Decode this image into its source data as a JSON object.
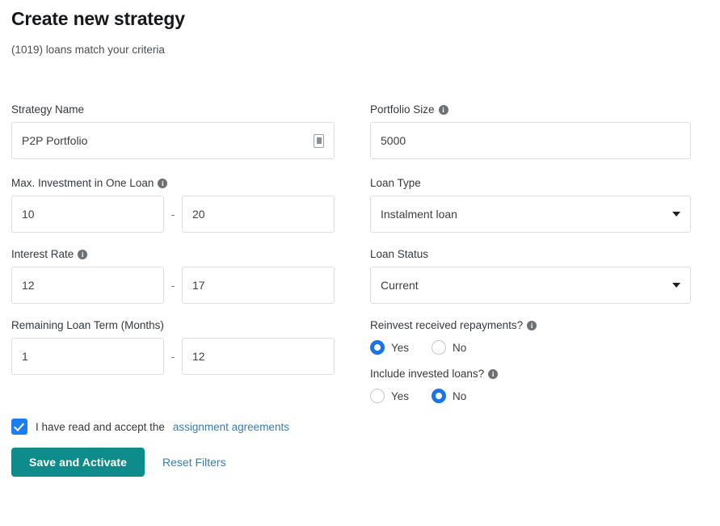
{
  "header": {
    "title": "Create new strategy",
    "subtitle": "(1019) loans match your criteria"
  },
  "left_column": {
    "strategy_name": {
      "label": "Strategy Name",
      "value": "P2P Portfolio",
      "trailing_icon": "id-card-icon"
    },
    "max_investment": {
      "label": "Max. Investment in One Loan",
      "info_icon": "info-icon",
      "info_glyph": "i",
      "min": "10",
      "max": "20",
      "separator": "-"
    },
    "interest_rate": {
      "label": "Interest Rate",
      "info_icon": "info-icon",
      "info_glyph": "i",
      "min": "12",
      "max": "17",
      "separator": "-"
    },
    "remaining_term": {
      "label": "Remaining Loan Term (Months)",
      "min": "1",
      "max": "12",
      "separator": "-"
    }
  },
  "right_column": {
    "portfolio_size": {
      "label": "Portfolio Size",
      "info_glyph": "i",
      "value": "5000"
    },
    "loan_type": {
      "label": "Loan Type",
      "value": "Instalment loan",
      "caret_icon": "chevron-down-icon"
    },
    "loan_status": {
      "label": "Loan Status",
      "value": "Current",
      "caret_icon": "chevron-down-icon"
    },
    "reinvest": {
      "label": "Reinvest received repayments?",
      "info_glyph": "i",
      "yes_label": "Yes",
      "no_label": "No",
      "selected": "Yes"
    },
    "include_invested": {
      "label": "Include invested loans?",
      "info_glyph": "i",
      "yes_label": "Yes",
      "no_label": "No",
      "selected": "No"
    }
  },
  "footer": {
    "accept_text": "I have read and accept the",
    "accept_link": "assignment agreements",
    "save_label": "Save and Activate",
    "reset_label": "Reset Filters"
  },
  "colors": {
    "primary_button": "#0e8c8c",
    "link": "#3a7cab",
    "checkbox": "#1a7ef0",
    "radio_selected": "#1a73e8",
    "border": "#dcdfe2",
    "text": "#3c4043"
  }
}
